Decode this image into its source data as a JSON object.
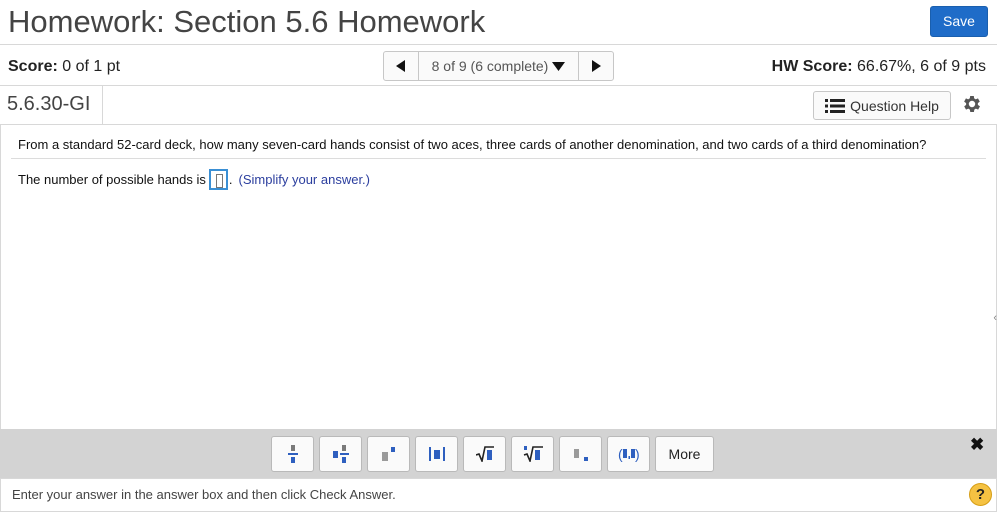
{
  "header": {
    "title": "Homework: Section 5.6 Homework",
    "save_label": "Save"
  },
  "score": {
    "label": "Score:",
    "value": "0 of 1 pt",
    "hw_label": "HW Score:",
    "hw_value": "66.67%, 6 of 9 pts"
  },
  "navigation": {
    "position": "8 of 9 (6 complete)"
  },
  "question": {
    "id": "5.6.30-GI",
    "help_label": "Question Help",
    "prompt": "From a standard 52-card deck, how many seven-card hands consist of two aces, three cards of another denomination, and two cards of a third denomination?",
    "answer_prefix": "The number of possible hands is",
    "answer_value": "",
    "answer_suffix": ".",
    "hint": "(Simplify your answer.)"
  },
  "toolbar": {
    "tools": [
      "fraction-icon",
      "mixed-number-icon",
      "exponent-icon",
      "absolute-value-icon",
      "square-root-icon",
      "nth-root-icon",
      "decimal-icon",
      "ordered-pair-icon"
    ],
    "more_label": "More",
    "close_icon": "close-icon"
  },
  "status": {
    "message": "Enter your answer in the answer box and then click Check Answer.",
    "help_icon": "?"
  },
  "colors": {
    "accent": "#1f6cc8",
    "hint": "#2b3e9e",
    "toolbar_bg": "#d3d3d3",
    "help": "#f5c242"
  }
}
